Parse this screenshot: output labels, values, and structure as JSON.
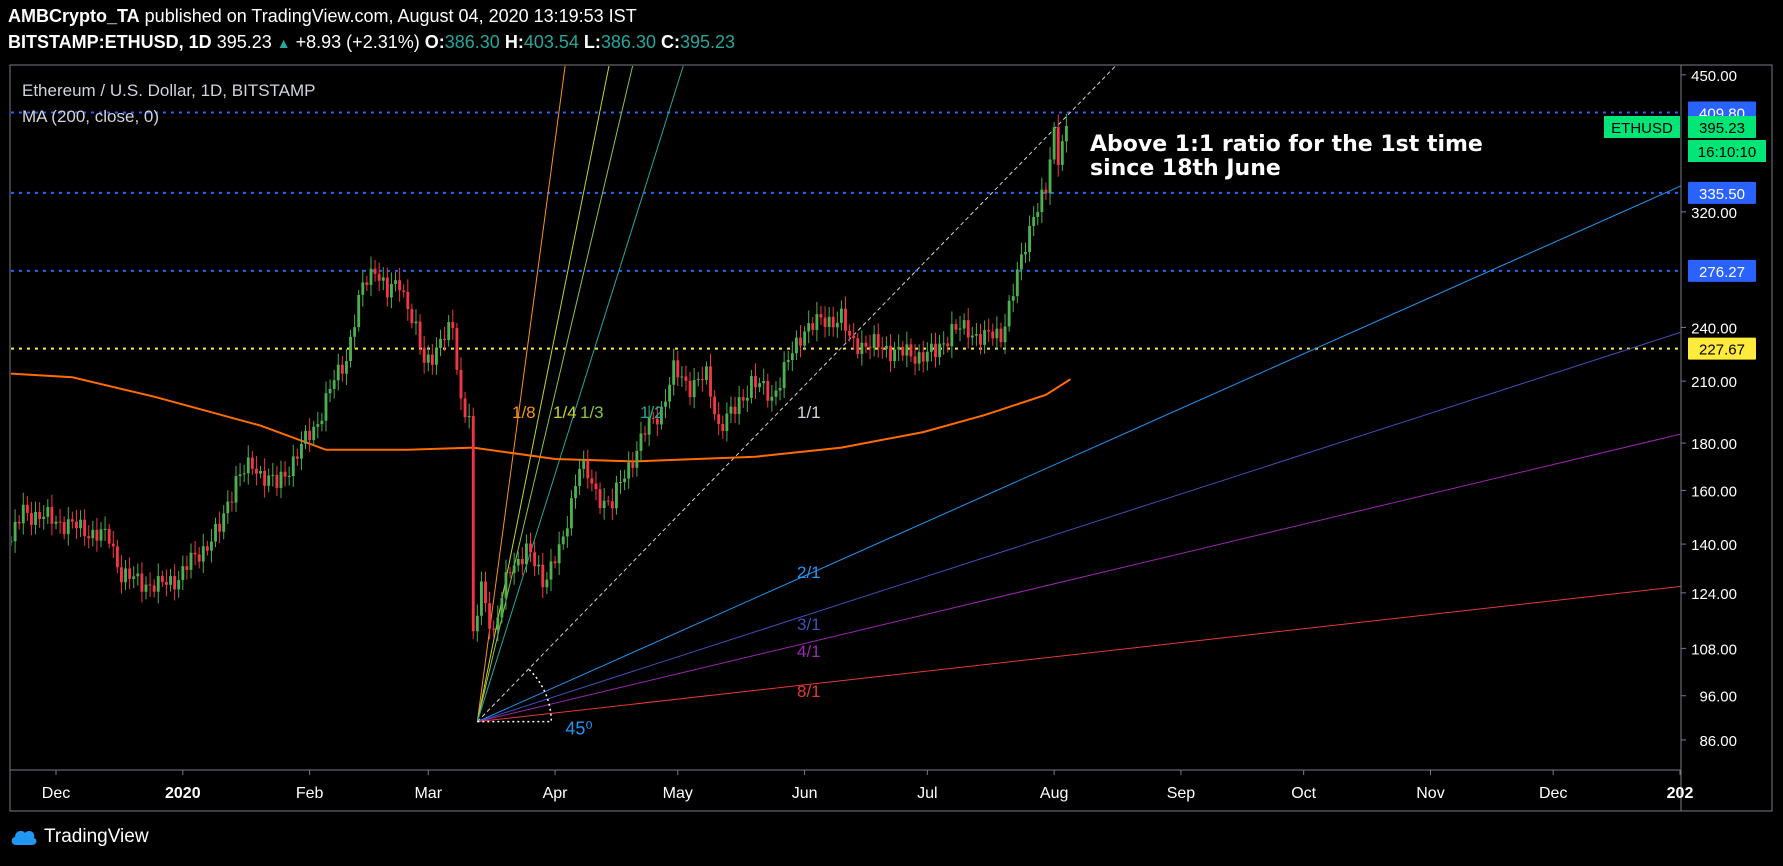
{
  "header": {
    "publisher": "AMBCrypto_TA",
    "published_text": " published on TradingView.com, August 04, 2020 13:19:53 IST",
    "symbol": "BITSTAMP:ETHUSD, 1D",
    "last": "395.23",
    "change": "+8.93 (+2.31%)",
    "o_label": "O:",
    "o": "386.30",
    "h_label": "H:",
    "h": "403.54",
    "l_label": "L:",
    "l": "386.30",
    "c_label": "C:",
    "c": "395.23"
  },
  "legend": {
    "title": "Ethereum / U.S. Dollar, 1D, BITSTAMP",
    "indicator": "MA (200, close, 0)"
  },
  "annotation": {
    "line1": "Above 1:1 ratio for the 1st time",
    "line2": "since 18th June"
  },
  "footer": {
    "brand": "TradingView"
  },
  "colors": {
    "background": "#000000",
    "frame": "#787b86",
    "up_candle": "#4caf50",
    "down_candle": "#f23645",
    "ma_line": "#ff6d00",
    "level_line": "#2962ff",
    "support_line": "#ffeb3b",
    "price_tag": "#00e676"
  },
  "chart_data": {
    "type": "candlestick",
    "timeframe": "1D",
    "ylim": [
      80,
      460
    ],
    "y_scale": "log",
    "y_ticks": [
      450,
      320,
      240,
      210,
      180,
      160,
      140,
      124,
      108,
      96,
      86
    ],
    "y_tick_labels": [
      "450.00",
      "320.00",
      "240.00",
      "210.00",
      "180.00",
      "160.00",
      "140.00",
      "124.00",
      "108.00",
      "96.00",
      "86.00"
    ],
    "xlim": [
      "2019-11-20",
      "2021-01-01"
    ],
    "x_ticks": [
      {
        "date": "2019-12-01",
        "label": "Dec",
        "bold": false
      },
      {
        "date": "2020-01-01",
        "label": "2020",
        "bold": true
      },
      {
        "date": "2020-02-01",
        "label": "Feb",
        "bold": false
      },
      {
        "date": "2020-03-01",
        "label": "Mar",
        "bold": false
      },
      {
        "date": "2020-04-01",
        "label": "Apr",
        "bold": false
      },
      {
        "date": "2020-05-01",
        "label": "May",
        "bold": false
      },
      {
        "date": "2020-06-01",
        "label": "Jun",
        "bold": false
      },
      {
        "date": "2020-07-01",
        "label": "Jul",
        "bold": false
      },
      {
        "date": "2020-08-01",
        "label": "Aug",
        "bold": false
      },
      {
        "date": "2020-09-01",
        "label": "Sep",
        "bold": false
      },
      {
        "date": "2020-10-01",
        "label": "Oct",
        "bold": false
      },
      {
        "date": "2020-11-01",
        "label": "Nov",
        "bold": false
      },
      {
        "date": "2020-12-01",
        "label": "Dec",
        "bold": false
      },
      {
        "date": "2021-01-01",
        "label": "202",
        "bold": true
      }
    ],
    "price_path": [
      {
        "date": "2019-11-20",
        "price": 141
      },
      {
        "date": "2019-11-23",
        "price": 152
      },
      {
        "date": "2019-11-27",
        "price": 150
      },
      {
        "date": "2019-12-02",
        "price": 148
      },
      {
        "date": "2019-12-08",
        "price": 145
      },
      {
        "date": "2019-12-14",
        "price": 142
      },
      {
        "date": "2019-12-17",
        "price": 130
      },
      {
        "date": "2019-12-20",
        "price": 128
      },
      {
        "date": "2019-12-26",
        "price": 126
      },
      {
        "date": "2019-12-31",
        "price": 129
      },
      {
        "date": "2020-01-03",
        "price": 134
      },
      {
        "date": "2020-01-07",
        "price": 140
      },
      {
        "date": "2020-01-10",
        "price": 145
      },
      {
        "date": "2020-01-14",
        "price": 165
      },
      {
        "date": "2020-01-18",
        "price": 170
      },
      {
        "date": "2020-01-24",
        "price": 162
      },
      {
        "date": "2020-01-29",
        "price": 175
      },
      {
        "date": "2020-02-03",
        "price": 190
      },
      {
        "date": "2020-02-07",
        "price": 210
      },
      {
        "date": "2020-02-10",
        "price": 223
      },
      {
        "date": "2020-02-14",
        "price": 265
      },
      {
        "date": "2020-02-17",
        "price": 280
      },
      {
        "date": "2020-02-20",
        "price": 260
      },
      {
        "date": "2020-02-23",
        "price": 270
      },
      {
        "date": "2020-02-26",
        "price": 245
      },
      {
        "date": "2020-02-29",
        "price": 220
      },
      {
        "date": "2020-03-03",
        "price": 228
      },
      {
        "date": "2020-03-07",
        "price": 240
      },
      {
        "date": "2020-03-09",
        "price": 200
      },
      {
        "date": "2020-03-11",
        "price": 192
      },
      {
        "date": "2020-03-12",
        "price": 110
      },
      {
        "date": "2020-03-14",
        "price": 126
      },
      {
        "date": "2020-03-17",
        "price": 112
      },
      {
        "date": "2020-03-21",
        "price": 132
      },
      {
        "date": "2020-03-25",
        "price": 138
      },
      {
        "date": "2020-03-29",
        "price": 128
      },
      {
        "date": "2020-04-03",
        "price": 140
      },
      {
        "date": "2020-04-07",
        "price": 172
      },
      {
        "date": "2020-04-11",
        "price": 158
      },
      {
        "date": "2020-04-15",
        "price": 155
      },
      {
        "date": "2020-04-19",
        "price": 170
      },
      {
        "date": "2020-04-23",
        "price": 185
      },
      {
        "date": "2020-04-27",
        "price": 196
      },
      {
        "date": "2020-04-30",
        "price": 215
      },
      {
        "date": "2020-05-04",
        "price": 208
      },
      {
        "date": "2020-05-08",
        "price": 212
      },
      {
        "date": "2020-05-11",
        "price": 188
      },
      {
        "date": "2020-05-15",
        "price": 195
      },
      {
        "date": "2020-05-19",
        "price": 210
      },
      {
        "date": "2020-05-24",
        "price": 202
      },
      {
        "date": "2020-05-28",
        "price": 220
      },
      {
        "date": "2020-06-01",
        "price": 240
      },
      {
        "date": "2020-06-06",
        "price": 244
      },
      {
        "date": "2020-06-10",
        "price": 246
      },
      {
        "date": "2020-06-12",
        "price": 232
      },
      {
        "date": "2020-06-16",
        "price": 230
      },
      {
        "date": "2020-06-21",
        "price": 228
      },
      {
        "date": "2020-06-25",
        "price": 225
      },
      {
        "date": "2020-06-28",
        "price": 224
      },
      {
        "date": "2020-07-03",
        "price": 225
      },
      {
        "date": "2020-07-07",
        "price": 239
      },
      {
        "date": "2020-07-11",
        "price": 238
      },
      {
        "date": "2020-07-15",
        "price": 234
      },
      {
        "date": "2020-07-19",
        "price": 236
      },
      {
        "date": "2020-07-22",
        "price": 262
      },
      {
        "date": "2020-07-24",
        "price": 283
      },
      {
        "date": "2020-07-27",
        "price": 320
      },
      {
        "date": "2020-07-30",
        "price": 335
      },
      {
        "date": "2020-08-01",
        "price": 390
      },
      {
        "date": "2020-08-02",
        "price": 370
      },
      {
        "date": "2020-08-04",
        "price": 395
      }
    ],
    "ma200": [
      {
        "date": "2019-11-20",
        "value": 214
      },
      {
        "date": "2019-12-05",
        "value": 212
      },
      {
        "date": "2019-12-25",
        "value": 202
      },
      {
        "date": "2020-01-20",
        "value": 188
      },
      {
        "date": "2020-02-05",
        "value": 177
      },
      {
        "date": "2020-02-25",
        "value": 177
      },
      {
        "date": "2020-03-12",
        "value": 178
      },
      {
        "date": "2020-04-01",
        "value": 173
      },
      {
        "date": "2020-04-20",
        "value": 172
      },
      {
        "date": "2020-05-20",
        "value": 174
      },
      {
        "date": "2020-06-10",
        "value": 178
      },
      {
        "date": "2020-06-30",
        "value": 185
      },
      {
        "date": "2020-07-15",
        "value": 193
      },
      {
        "date": "2020-07-30",
        "value": 203
      },
      {
        "date": "2020-08-05",
        "value": 211
      }
    ],
    "horizontal_levels": [
      {
        "price": 409.8,
        "label": "409.80",
        "color": "#2962ff"
      },
      {
        "price": 335.5,
        "label": "335.50",
        "color": "#2962ff"
      },
      {
        "price": 276.27,
        "label": "276.27",
        "color": "#2962ff"
      },
      {
        "price": 227.67,
        "label": "227.67",
        "color": "#ffeb3b"
      }
    ],
    "last_price": {
      "value": 395.23,
      "label": "395.23",
      "symbol": "ETHUSD",
      "countdown": "16:10:10"
    },
    "gann_fan": {
      "origin": {
        "date": "2020-03-13",
        "price": 90
      },
      "angle_label": "45⁰",
      "lines": [
        {
          "label": "1/8",
          "through": {
            "date": "2020-04-08",
            "price": 650
          },
          "color": "#f7931a"
        },
        {
          "label": "1/4",
          "through": {
            "date": "2020-04-21",
            "price": 650
          },
          "color": "#c7d42b"
        },
        {
          "label": "1/3",
          "through": {
            "date": "2020-04-28",
            "price": 650
          },
          "color": "#8bc34a"
        },
        {
          "label": "1/2",
          "through": {
            "date": "2020-05-13",
            "price": 650
          },
          "color": "#26a69a"
        },
        {
          "label": "1/1",
          "through": {
            "date": "2020-08-05",
            "price": 410
          },
          "color": "#d1d4dc"
        },
        {
          "label": "2/1",
          "through": {
            "date": "2021-01-01",
            "price": 341
          },
          "color": "#2196f3"
        },
        {
          "label": "3/1",
          "through": {
            "date": "2021-01-01",
            "price": 237
          },
          "color": "#3f51b5"
        },
        {
          "label": "4/1",
          "through": {
            "date": "2021-01-01",
            "price": 184
          },
          "color": "#9c27b0"
        },
        {
          "label": "8/1",
          "through": {
            "date": "2021-01-01",
            "price": 126
          },
          "color": "#e53935"
        }
      ]
    }
  }
}
